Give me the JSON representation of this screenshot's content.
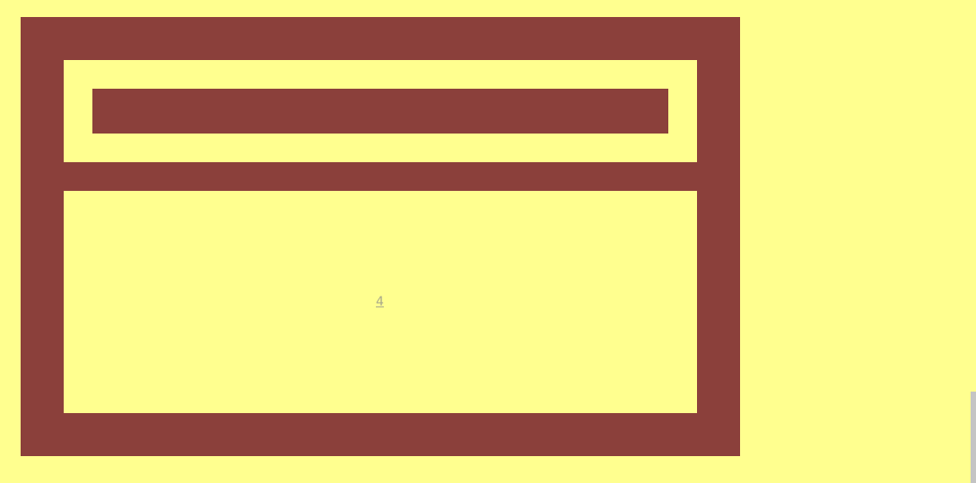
{
  "colors": {
    "background": "#ffff8f",
    "frame": "#8b403b",
    "link": "#a8a88a",
    "scrollbar_thumb": "#c4c4c4"
  },
  "content": {
    "link_text": "4"
  }
}
